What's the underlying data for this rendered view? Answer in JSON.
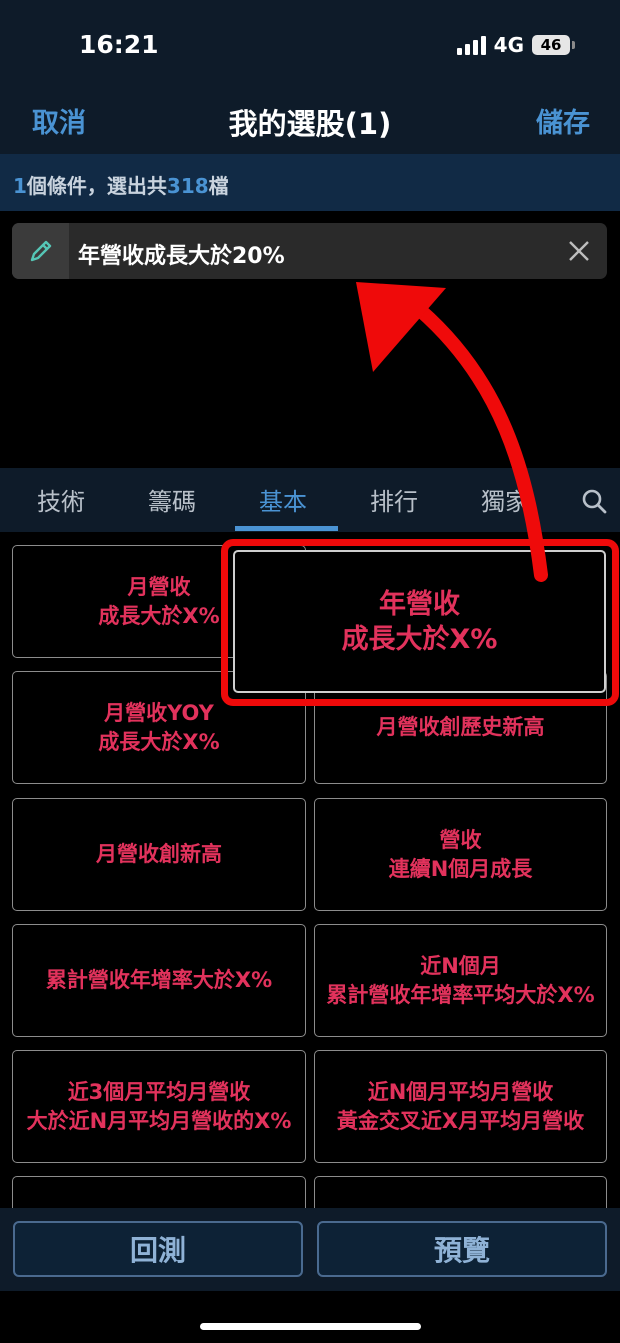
{
  "status": {
    "time": "16:21",
    "network": "4G",
    "battery": "46"
  },
  "nav": {
    "cancel": "取消",
    "title": "我的選股(1)",
    "save": "儲存"
  },
  "summary": {
    "count": "1",
    "text1": "個條件，選出共",
    "total": "318",
    "text2": "檔"
  },
  "condition": {
    "label": "年營收成長大於20%"
  },
  "tabs": [
    {
      "label": "技術"
    },
    {
      "label": "籌碼"
    },
    {
      "label": "基本",
      "active": true
    },
    {
      "label": "排行"
    },
    {
      "label": "獨家"
    }
  ],
  "tiles": [
    {
      "label": "月營收\n成長大於X%"
    },
    {
      "label": "年營收\n成長大於X%"
    },
    {
      "label": "月營收YOY\n成長大於X%"
    },
    {
      "label": "月營收創歷史新高"
    },
    {
      "label": "月營收創新高"
    },
    {
      "label": "營收\n連續N個月成長"
    },
    {
      "label": "累計營收年增率大於X%"
    },
    {
      "label": "近N個月\n累計營收年增率平均大於X%"
    },
    {
      "label": "近3個月平均月營收\n大於近N月平均月營收的X%"
    },
    {
      "label": "近N個月平均月營收\n黃金交叉近X月平均月營收"
    }
  ],
  "buttons": {
    "backtest": "回測",
    "preview": "預覽"
  },
  "colors": {
    "accent": "#4a93d3",
    "tile_text": "#e2325c",
    "annotation": "#ef0a0a"
  }
}
